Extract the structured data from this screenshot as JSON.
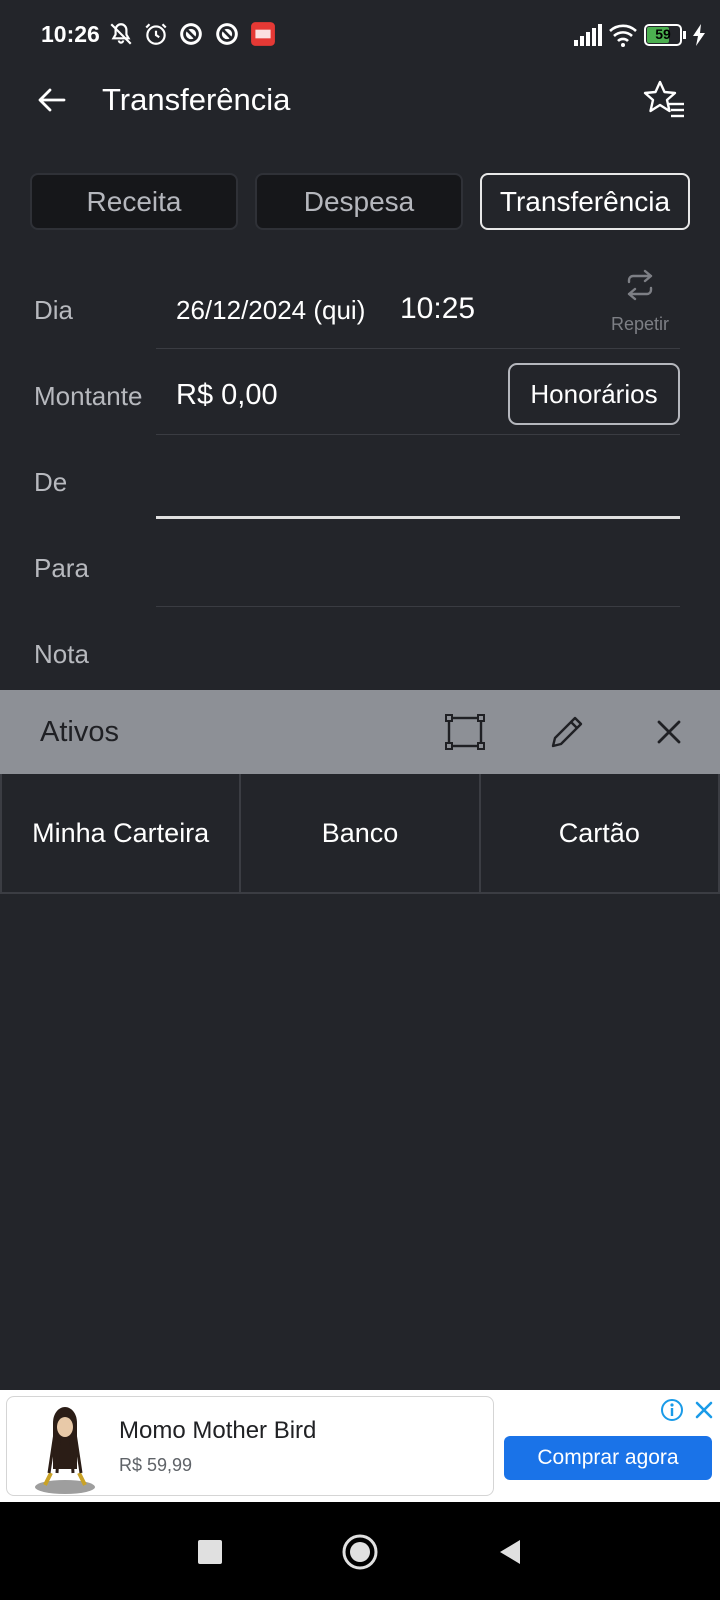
{
  "status_bar": {
    "time": "10:26",
    "battery": "59",
    "icons": [
      "mute-icon",
      "alarm-icon",
      "vpn-icon",
      "vpn-icon",
      "app-notification-icon",
      "signal-icon",
      "wifi-icon",
      "battery-icon",
      "charging-icon"
    ]
  },
  "header": {
    "title": "Transferência",
    "back_icon": "arrow-left-icon",
    "favorites_icon": "star-list-icon"
  },
  "type_tabs": [
    {
      "label": "Receita",
      "selected": false
    },
    {
      "label": "Despesa",
      "selected": false
    },
    {
      "label": "Transferência",
      "selected": true
    }
  ],
  "form": {
    "day_label": "Dia",
    "date_value": "26/12/2024 (qui)",
    "time_value": "10:25",
    "repeat_label": "Repetir",
    "amount_label": "Montante",
    "amount_value": "R$ 0,00",
    "fees_button": "Honorários",
    "from_label": "De",
    "from_value": "",
    "to_label": "Para",
    "to_value": "",
    "note_label": "Nota"
  },
  "accounts_panel": {
    "title": "Ativos",
    "items": [
      "Minha Carteira",
      "Banco",
      "Cartão"
    ]
  },
  "ad": {
    "title": "Momo Mother Bird",
    "price": "R$ 59,99",
    "cta": "Comprar agora"
  },
  "colors": {
    "background": "#23252a",
    "panel_header": "#8d9096",
    "ad_button": "#1a73e8"
  }
}
